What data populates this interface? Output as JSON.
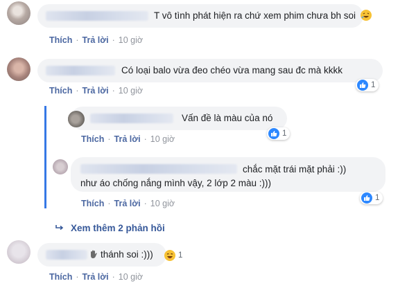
{
  "comments": [
    {
      "text": "T vô tình phát hiện ra chứ xem phim chưa bh soi",
      "like": "Thích",
      "reply": "Trả lời",
      "time": "10 giờ"
    },
    {
      "text": "Có loại balo vừa đeo chéo vừa mang sau đc mà kkkk",
      "like": "Thích",
      "reply": "Trả lời",
      "time": "10 giờ",
      "reaction_count": "1"
    },
    {
      "text": "Vấn đề là màu của nó",
      "like": "Thích",
      "reply": "Trả lời",
      "time": "10 giờ",
      "reaction_count": "1"
    },
    {
      "line1": "chắc mặt trái mặt phải :))",
      "line2": "như áo chống nắng mình vậy, 2 lớp 2 màu :)))",
      "like": "Thích",
      "reply": "Trả lời",
      "time": "10 giờ",
      "reaction_count": "1"
    },
    {
      "text": "thánh soi :)))",
      "like": "Thích",
      "reply": "Trả lời",
      "time": "10 giờ",
      "reaction_count": "1"
    }
  ],
  "more_replies": "Xem thêm 2 phản hồi",
  "colors": {
    "link": "#4b67a1",
    "like_blue": "#2d88ff",
    "thread_line": "#3578e5",
    "bubble": "#f2f3f5"
  },
  "icons": [
    "like-icon",
    "haha-icon",
    "laughing-emoji-icon",
    "wave-hand-icon",
    "reply-arrow-icon"
  ]
}
